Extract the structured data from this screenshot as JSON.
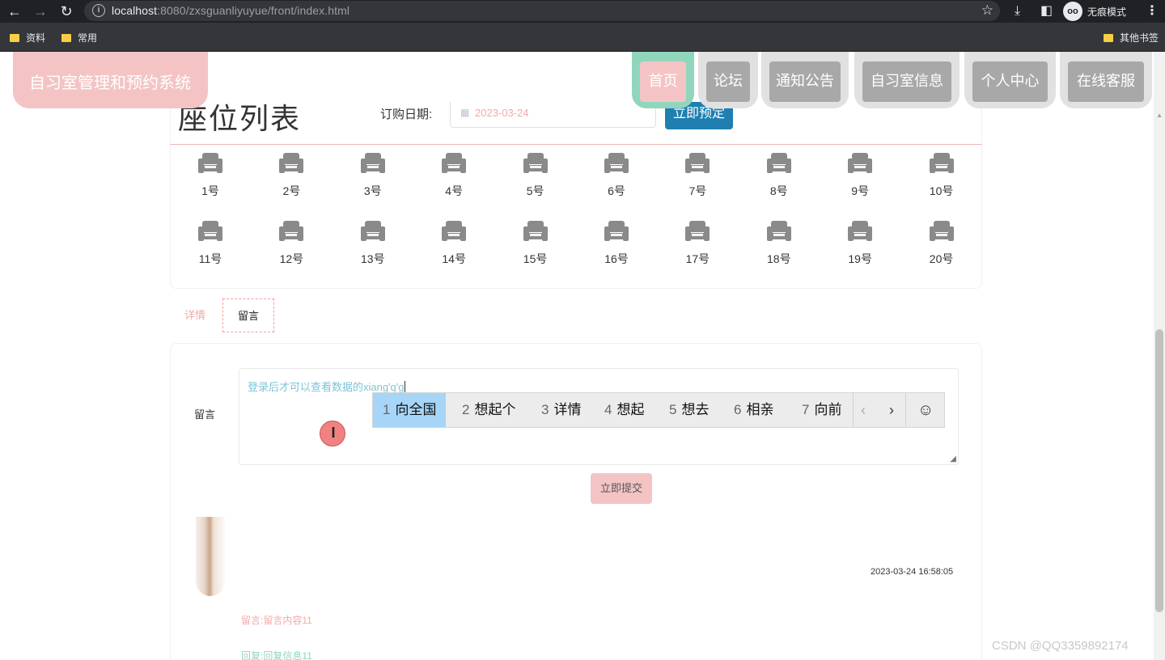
{
  "browser": {
    "url_host": "localhost",
    "url_rest": ":8080/zxsguanliyuyue/front/index.html",
    "incognito_label": "无痕模式",
    "bookmarks": [
      "资料",
      "常用"
    ],
    "other_bookmarks": "其他书签"
  },
  "brand": "自习室管理和预约系统",
  "nav": [
    "首页",
    "论坛",
    "通知公告",
    "自习室信息",
    "个人中心",
    "在线客服"
  ],
  "seat_section": {
    "title": "座位列表",
    "date_label": "订购日期:",
    "date_value": "2023-03-24",
    "book_button": "立即预定",
    "seats": [
      "1号",
      "2号",
      "3号",
      "4号",
      "5号",
      "6号",
      "7号",
      "8号",
      "9号",
      "10号",
      "11号",
      "12号",
      "13号",
      "14号",
      "15号",
      "16号",
      "17号",
      "18号",
      "19号",
      "20号"
    ]
  },
  "tabs": {
    "detail": "详情",
    "message": "留言"
  },
  "message_form": {
    "label": "留言",
    "textarea_value": "登录后才可以查看数据的xiang'q'g",
    "submit": "立即提交"
  },
  "ime": {
    "candidates": [
      {
        "n": "1",
        "text": "向全国"
      },
      {
        "n": "2",
        "text": "想起个"
      },
      {
        "n": "3",
        "text": "详情"
      },
      {
        "n": "4",
        "text": "想起"
      },
      {
        "n": "5",
        "text": "想去"
      },
      {
        "n": "6",
        "text": "相亲"
      },
      {
        "n": "7",
        "text": "向前"
      }
    ],
    "prev": "‹",
    "next": "›",
    "emoji": "☺"
  },
  "comment": {
    "timestamp": "2023-03-24 16:58:05",
    "text": "留言:留言内容11",
    "reply": "回复:回复信息11"
  },
  "watermark": "CSDN @QQ3359892174",
  "colors": {
    "primary_pink": "#f4c4c4",
    "accent_green": "#8fd6bc",
    "book_blue": "#1e7fb0"
  }
}
